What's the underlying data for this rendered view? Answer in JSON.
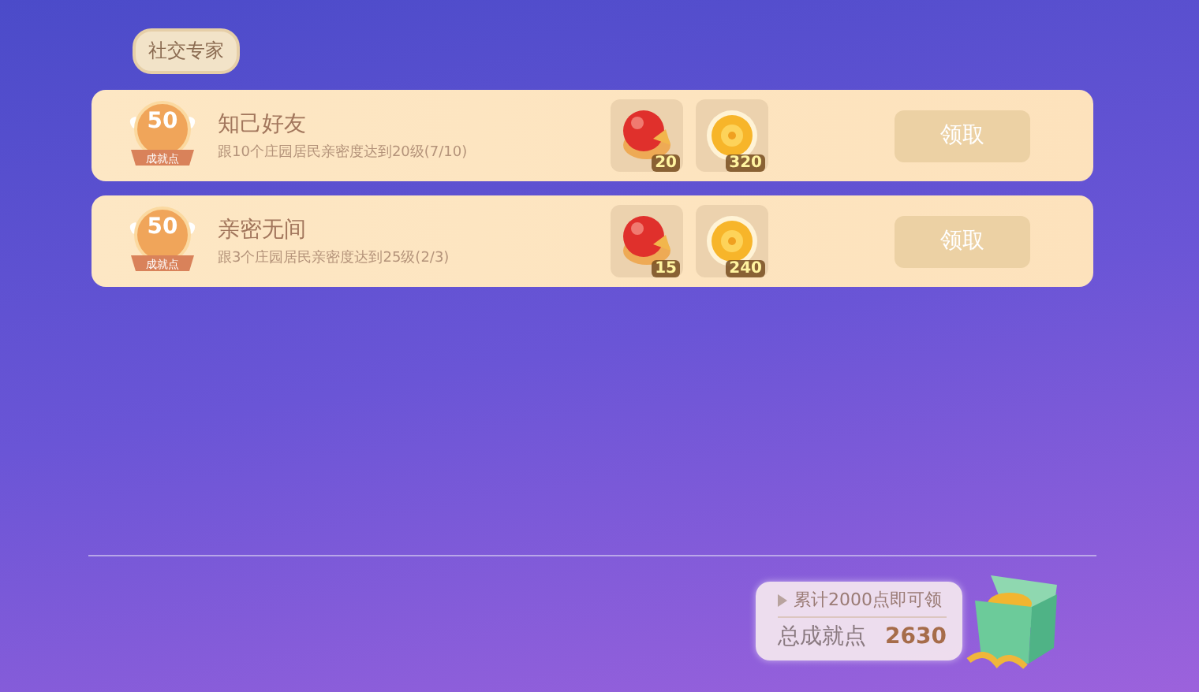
{
  "section": {
    "title": "社交专家"
  },
  "achievements": [
    {
      "points": "50",
      "points_label": "成就点",
      "title": "知己好友",
      "description": "跟10个庄园居民亲密度达到20级(7/10)",
      "rewards": [
        {
          "kind": "fruit",
          "count": "20"
        },
        {
          "kind": "coin",
          "count": "320"
        }
      ],
      "button": {
        "label": "领取",
        "disabled": true
      }
    },
    {
      "points": "50",
      "points_label": "成就点",
      "title": "亲密无间",
      "description": "跟3个庄园居民亲密度达到25级(2/3)",
      "rewards": [
        {
          "kind": "fruit",
          "count": "15"
        },
        {
          "kind": "coin",
          "count": "240"
        }
      ],
      "button": {
        "label": "领取",
        "disabled": true
      }
    }
  ],
  "footer": {
    "hint": "累计2000点即可领",
    "total_label": "总成就点",
    "total_value": "2630"
  }
}
